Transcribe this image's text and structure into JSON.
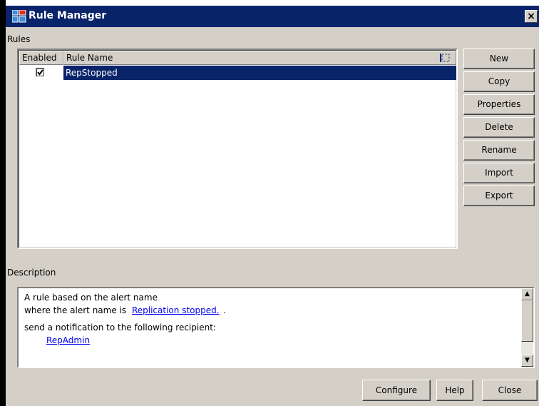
{
  "window": {
    "title": "Rule Manager",
    "close_glyph": "×"
  },
  "rules_section": {
    "label": "Rules",
    "columns": {
      "enabled": "Enabled",
      "rule_name": "Rule Name"
    },
    "rows": [
      {
        "enabled": true,
        "name": "RepStopped",
        "selected": true
      }
    ]
  },
  "side_buttons": [
    "New",
    "Copy",
    "Properties",
    "Delete",
    "Rename",
    "Import",
    "Export"
  ],
  "description_section": {
    "label": "Description",
    "line1": "A rule based on the alert name",
    "line2_prefix": "where the alert name is",
    "line2_link": "Replication stopped.",
    "line2_suffix": ".",
    "line3": "send a notification to the following recipient:",
    "recipient_link": "RepAdmin"
  },
  "bottom_buttons": {
    "configure": "Configure",
    "help": "Help",
    "close": "Close"
  },
  "colors": {
    "titlebar": "#0a246a",
    "selection": "#0a246a",
    "face": "#d4d0c8",
    "link": "#0000ee"
  },
  "icons": {
    "app": "rule-manager-icon",
    "column_menu": "column-chooser-icon",
    "check": "checkmark-icon"
  }
}
